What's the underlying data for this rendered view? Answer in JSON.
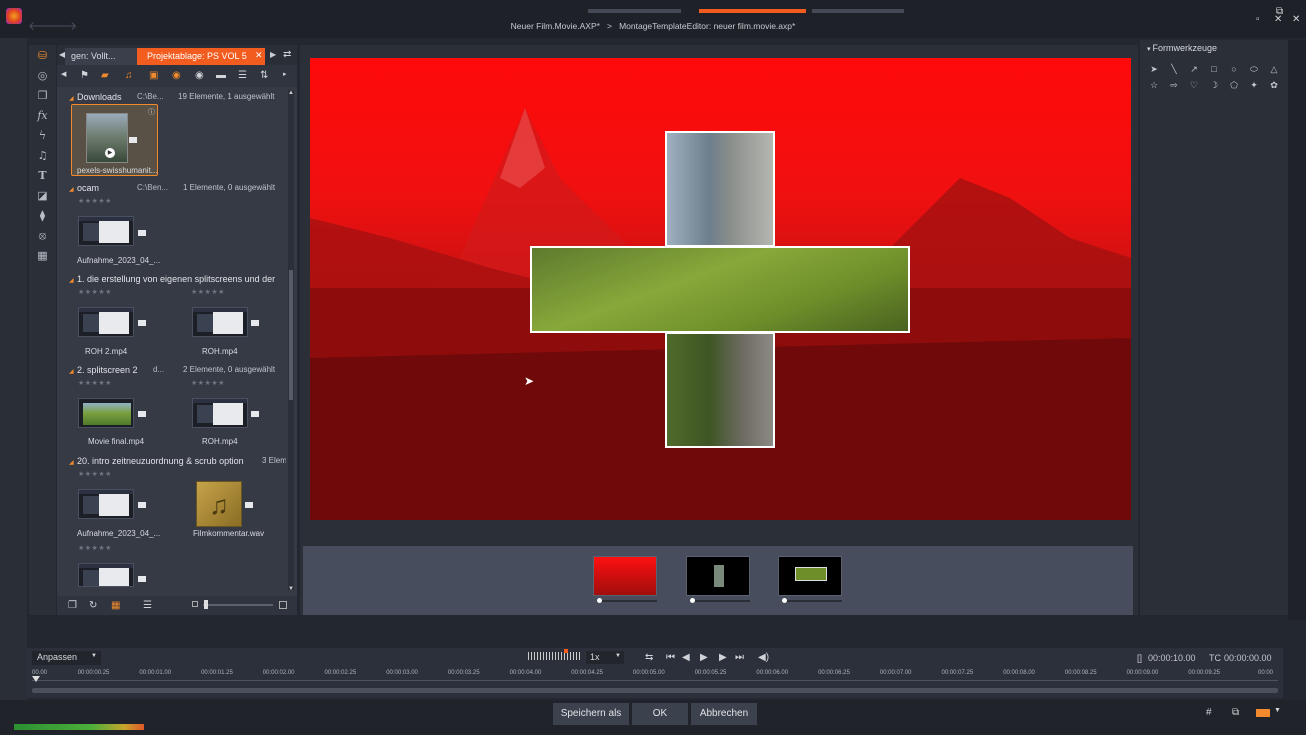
{
  "window": {
    "title": "Neuer Film.Movie.AXP*   >   MontageTemplateEditor: neuer film.movie.axp*",
    "controls": [
      "▫",
      "⧉",
      "✕"
    ]
  },
  "library": {
    "tab_left": "gen: Vollt...",
    "tab_active": "Projektablage: PS VOL 5",
    "groups": [
      {
        "title": "Downloads",
        "path": "C:\\Be...",
        "count": "19 Elemente, 1 ausgewählt",
        "items": [
          {
            "name": "pexels-swisshumanit..."
          }
        ]
      },
      {
        "title": "ocam",
        "path": "C:\\Ben...",
        "count": "1 Elemente, 0 ausgewählt",
        "items": [
          {
            "name": "Aufnahme_2023_04_..."
          }
        ]
      },
      {
        "title": "1. die erstellung von eigenen splitscreens und der",
        "path": "",
        "count": "",
        "items": [
          {
            "name": "ROH 2.mp4"
          },
          {
            "name": "ROH.mp4"
          }
        ]
      },
      {
        "title": "2. splitscreen 2",
        "path": "d...",
        "count": "2 Elemente, 0 ausgewählt",
        "items": [
          {
            "name": "Movie final.mp4"
          },
          {
            "name": "ROH.mp4"
          }
        ]
      },
      {
        "title": "20. intro zeitneuzuordnung & scrub option",
        "path": "",
        "count": "3 Elem",
        "items": [
          {
            "name": "Aufnahme_2023_04_..."
          },
          {
            "name": "Filmkommentar.wav"
          }
        ]
      }
    ],
    "stars": "★★★★★"
  },
  "formwerkzeuge": {
    "title": "Formwerkzeuge",
    "row1": [
      "➤",
      "╲",
      "↗",
      "□",
      "○",
      "⬭",
      "△"
    ],
    "row2": [
      "☆",
      "⇨",
      "♡",
      "☽",
      "⬠",
      "✦",
      "✿"
    ]
  },
  "timeline": {
    "fit": "Anpassen",
    "speed": "1x",
    "duration_tc": "00:00:10.00",
    "tc_label": "TC",
    "current_tc": "00:00:00.00",
    "ticks": [
      "00.00",
      "00:00:00.25",
      "00:00:01.00",
      "00:00:01.25",
      "00:00:02.00",
      "00:00:02.25",
      "00:00:03.00",
      "00:00:03.25",
      "00:00:04.00",
      "00:00:04.25",
      "00:00:05.00",
      "00:00:05.25",
      "00:00:06.00",
      "00:00:06.25",
      "00:00:07.00",
      "00:00:07.25",
      "00:00:08.00",
      "00:00:08.25",
      "00:00:09.00",
      "00:00:09.25",
      "00:00"
    ]
  },
  "buttons": {
    "save_as": "Speichern als",
    "ok": "OK",
    "cancel": "Abbrechen"
  },
  "colors": {
    "accent": "#f25c1e",
    "preview_tint": "#ff0a0a"
  }
}
